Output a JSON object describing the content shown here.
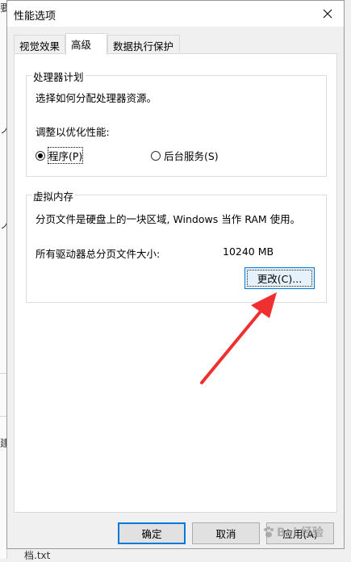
{
  "background": {
    "fragments": [
      "要",
      "ノ",
      "ノ",
      "建"
    ],
    "bottom_file": "档.txt"
  },
  "dialog": {
    "title": "性能选项",
    "tabs": [
      {
        "label": "视觉效果"
      },
      {
        "label": "高级"
      },
      {
        "label": "数据执行保护"
      }
    ],
    "processor_group": {
      "label": "处理器计划",
      "description": "选择如何分配处理器资源。",
      "adjust_label": "调整以优化性能:",
      "options": [
        {
          "label": "程序(P)",
          "selected": true
        },
        {
          "label": "后台服务(S)",
          "selected": false
        }
      ]
    },
    "virtual_memory_group": {
      "label": "虚拟内存",
      "description": "分页文件是硬盘上的一块区域, Windows 当作 RAM 使用。",
      "total_label": "所有驱动器总分页文件大小:",
      "total_value": "10240 MB",
      "change_button": "更改(C)..."
    },
    "buttons": {
      "ok": "确定",
      "cancel": "取消",
      "apply": "应用(A)"
    }
  },
  "annotation": {
    "arrow_color": "#f03030"
  },
  "watermark": {
    "text": "Bai 经验"
  }
}
